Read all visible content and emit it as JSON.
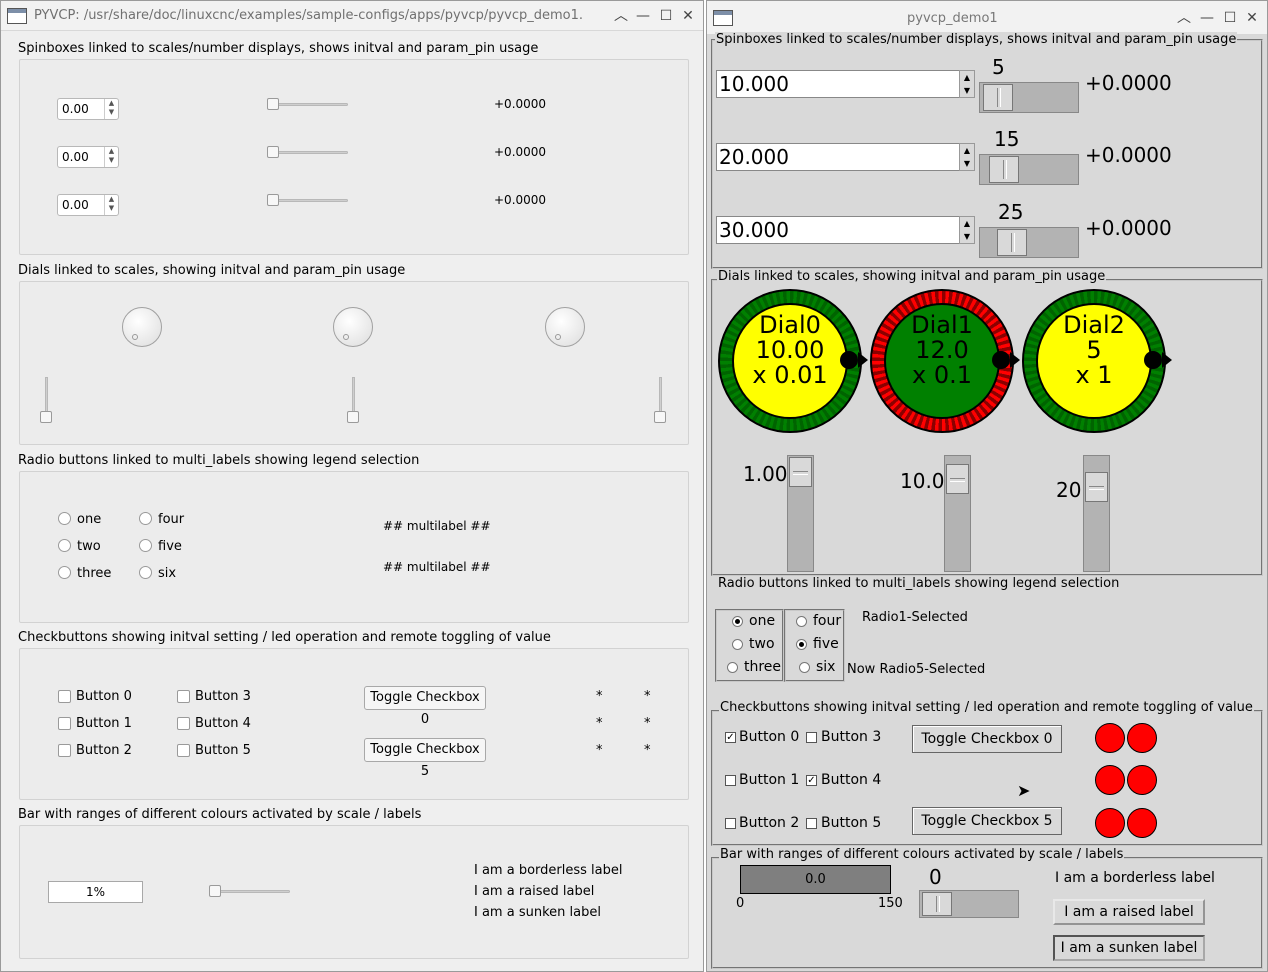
{
  "left": {
    "title": "PYVCP: /usr/share/doc/linuxcnc/examples/sample-configs/apps/pyvcp/pyvcp_demo1.",
    "spin_section": "Spinboxes linked to scales/number displays, shows initval and param_pin usage",
    "spins": [
      {
        "value": "0.00",
        "readout": "+0.0000"
      },
      {
        "value": "0.00",
        "readout": "+0.0000"
      },
      {
        "value": "0.00",
        "readout": "+0.0000"
      }
    ],
    "dial_section": "Dials linked to scales, showing initval and param_pin usage",
    "radio_section": "Radio buttons linked to multi_labels showing legend selection",
    "radios1": [
      "one",
      "two",
      "three"
    ],
    "radios2": [
      "four",
      "five",
      "six"
    ],
    "multilabel1": "## multilabel ##",
    "multilabel2": "## multilabel ##",
    "check_section": "Checkbuttons showing initval setting / led operation and remote toggling of value",
    "checks1": [
      "Button 0",
      "Button 1",
      "Button 2"
    ],
    "checks2": [
      "Button 3",
      "Button 4",
      "Button 5"
    ],
    "toggle0": "Toggle Checkbox 0",
    "toggle5": "Toggle Checkbox 5",
    "stars": [
      "*",
      "*",
      "*",
      "*",
      "*",
      "*"
    ],
    "bar_section": "Bar with ranges of different colours activated by scale / labels",
    "bar_value": "1%",
    "labels": [
      "I am a borderless label",
      "I am a raised label",
      "I am a sunken label"
    ]
  },
  "right": {
    "title": "pyvcp_demo1",
    "spin_section": "Spinboxes linked to scales/number displays, shows initval and param_pin usage",
    "spins": [
      {
        "value": "10.000",
        "scale": "5",
        "readout": "+0.0000"
      },
      {
        "value": "20.000",
        "scale": "15",
        "readout": "+0.0000"
      },
      {
        "value": "30.000",
        "scale": "25",
        "readout": "+0.0000"
      }
    ],
    "dial_section": "Dials linked to scales, showing initval and param_pin usage",
    "dials": [
      {
        "name": "Dial0",
        "value": "10.00",
        "scale": "x 0.01",
        "face_color": "#ffff00",
        "ring_color": "#008000",
        "tick_color": "#006400"
      },
      {
        "name": "Dial1",
        "value": "12.0",
        "scale": "x 0.1",
        "face_color": "#008000",
        "ring_color": "#ff0000",
        "tick_color": "#8b0000"
      },
      {
        "name": "Dial2",
        "value": "5",
        "scale": "x 1",
        "face_color": "#ffff00",
        "ring_color": "#008000",
        "tick_color": "#006400"
      }
    ],
    "vscale_values": [
      "1.00",
      "10.0",
      "20"
    ],
    "radio_section": "Radio buttons linked to multi_labels showing legend selection",
    "radios1": [
      "one",
      "two",
      "three"
    ],
    "radios2": [
      "four",
      "five",
      "six"
    ],
    "multilabel1": "Radio1-Selected",
    "multilabel2": "Now Radio5-Selected",
    "check_section": "Checkbuttons showing initval setting / led operation and remote toggling of value",
    "checks1": [
      "Button 0",
      "Button 1",
      "Button 2"
    ],
    "checks2": [
      "Button 3",
      "Button 4",
      "Button 5"
    ],
    "check_mark": "✓",
    "toggle0": "Toggle Checkbox 0",
    "toggle5": "Toggle Checkbox 5",
    "led_color": "#ff0000",
    "bar_section": "Bar with ranges of different colours activated by scale / labels",
    "bar_value": "0.0",
    "bar_min": "0",
    "bar_max": "150",
    "bar_scale_value": "0",
    "labels": [
      "I am a borderless label",
      "I am a raised label",
      "I am a sunken label"
    ]
  }
}
